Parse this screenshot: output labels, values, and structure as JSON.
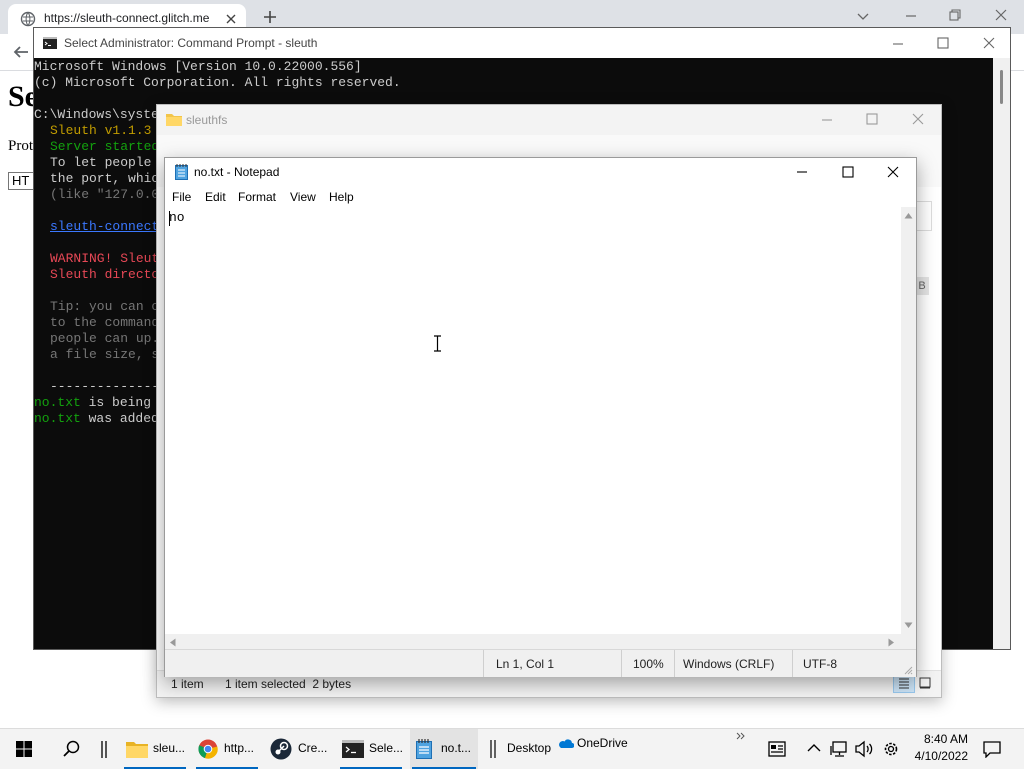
{
  "browser": {
    "tab_title": "https://sleuth-connect.glitch.me",
    "page_heading_fragment": "Se",
    "page_text_fragment": "Prot",
    "page_input_fragment": "HT"
  },
  "cmd": {
    "title": "Select Administrator: Command Prompt - sleuth",
    "lines": [
      {
        "text": "Microsoft Windows [Version 10.0.22000.556]",
        "color": "#cccccc",
        "indent": 0
      },
      {
        "text": "(c) Microsoft Corporation. All rights reserved.",
        "color": "#cccccc",
        "indent": 0
      },
      {
        "text": "",
        "color": "#cccccc",
        "indent": 0
      },
      {
        "text": "C:\\Windows\\syste",
        "color": "#cccccc",
        "indent": 0
      },
      {
        "text": "Sleuth v1.1.3",
        "color": "#c19c00",
        "indent": 2
      },
      {
        "text": "Server started",
        "color": "#13a10e",
        "indent": 2
      },
      {
        "text": "To let people",
        "color": "#cccccc",
        "indent": 2
      },
      {
        "text": "the port, whic",
        "color": "#cccccc",
        "indent": 2
      },
      {
        "text": "(like \"127.0.0",
        "color": "#767676",
        "indent": 2
      },
      {
        "text": "",
        "color": "#cccccc",
        "indent": 0
      },
      {
        "text": "sleuth-connect",
        "color": "#3b78ff",
        "indent": 2,
        "underline": true
      },
      {
        "text": "",
        "color": "#cccccc",
        "indent": 0
      },
      {
        "text": "WARNING! Sleut",
        "color": "#e74856",
        "indent": 2
      },
      {
        "text": "Sleuth directo",
        "color": "#e74856",
        "indent": 2
      },
      {
        "text": "",
        "color": "#cccccc",
        "indent": 0
      },
      {
        "text": "Tip: you can c",
        "color": "#767676",
        "indent": 2
      },
      {
        "text": "to the command",
        "color": "#767676",
        "indent": 2
      },
      {
        "text": "people can up.",
        "color": "#767676",
        "indent": 2
      },
      {
        "text": "a file size, s",
        "color": "#767676",
        "indent": 2
      },
      {
        "text": "",
        "color": "#cccccc",
        "indent": 0
      },
      {
        "text": "---------------",
        "color": "#cccccc",
        "indent": 2
      },
      {
        "text": "no.txt",
        "color": "#13a10e",
        "indent": 0,
        "suffix": " is being"
      },
      {
        "text": "no.txt",
        "color": "#13a10e",
        "indent": 0,
        "suffix": " was added"
      }
    ]
  },
  "explorer": {
    "title": "sleuthfs",
    "status": {
      "item_count": "1 item",
      "selection": "1 item selected  2 bytes"
    },
    "side_fragment": "B"
  },
  "notepad": {
    "title": "no.txt - Notepad",
    "menu": [
      "File",
      "Edit",
      "Format",
      "View",
      "Help"
    ],
    "content": "no",
    "status": {
      "position": "Ln 1, Col 1",
      "zoom": "100%",
      "line_ending": "Windows (CRLF)",
      "encoding": "UTF-8"
    }
  },
  "taskbar": {
    "items": [
      {
        "label": "sleu...",
        "icon": "folder-icon"
      },
      {
        "label": "http...",
        "icon": "chrome-icon"
      },
      {
        "label": "Cre...",
        "icon": "steam-icon"
      },
      {
        "label": "Sele...",
        "icon": "cmd-icon"
      },
      {
        "label": "no.t...",
        "icon": "notepad-icon"
      }
    ],
    "desktop_label": "Desktop",
    "onedrive_label": "OneDrive",
    "clock": {
      "time": "8:40 AM",
      "date": "4/10/2022"
    }
  },
  "colors": {
    "accent": "#0067c0",
    "cmd_background": "#0c0c0c",
    "cmd_green": "#13a10e",
    "cmd_red": "#e74856",
    "cmd_yellow": "#c19c00",
    "cmd_blue": "#3b78ff"
  }
}
